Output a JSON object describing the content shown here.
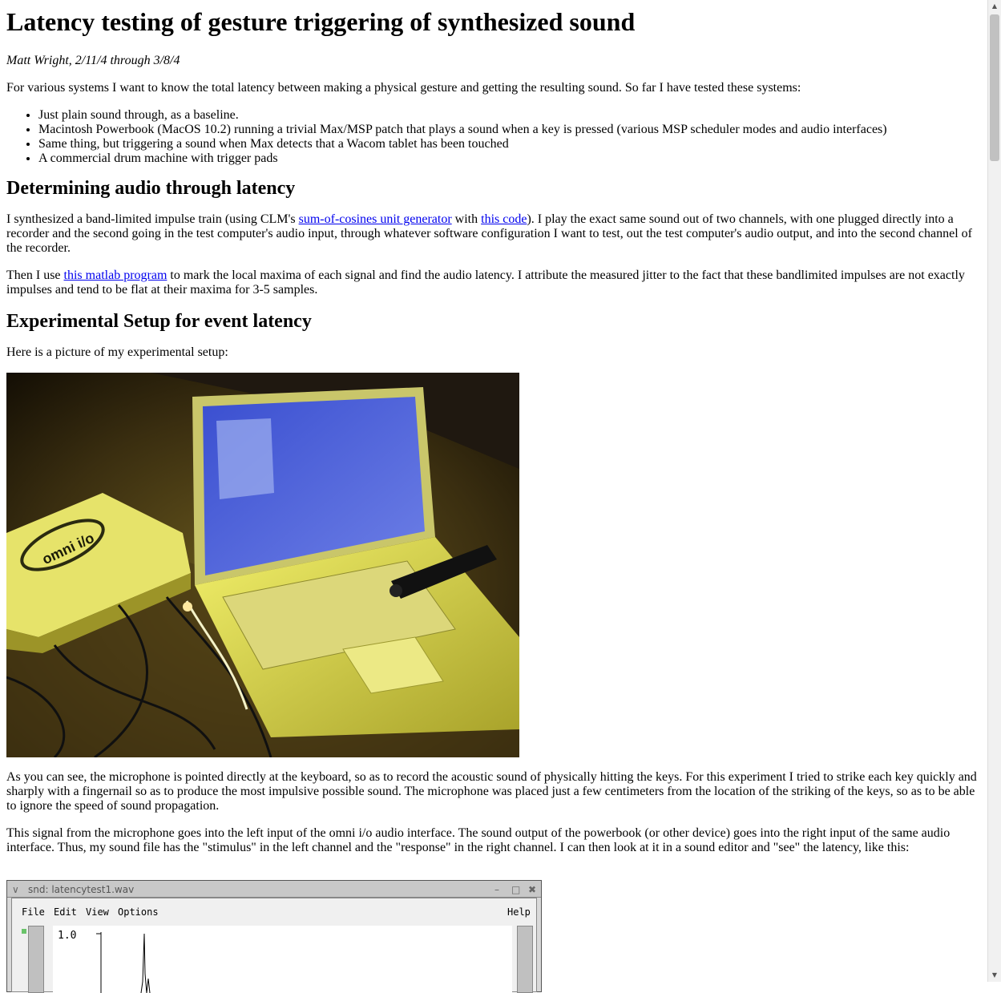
{
  "title": "Latency testing of gesture triggering of synthesized sound",
  "author_line": "Matt Wright, 2/11/4 through 3/8/4",
  "intro": "For various systems I want to know the total latency between making a physical gesture and getting the resulting sound. So far I have tested these systems:",
  "systems": [
    "Just plain sound through, as a baseline.",
    "Macintosh Powerbook (MacOS 10.2) running a trivial Max/MSP patch that plays a sound when a key is pressed (various MSP scheduler modes and audio interfaces)",
    "Same thing, but triggering a sound when Max detects that a Wacom tablet has been touched",
    "A commercial drum machine with trigger pads"
  ],
  "section_audio": {
    "heading": "Determining audio through latency",
    "p1_a": "I synthesized a band-limited impulse train (using CLM's ",
    "p1_link1": "sum-of-cosines unit generator",
    "p1_b": " with ",
    "p1_link2": "this code",
    "p1_c": "). I play the exact same sound out of two channels, with one plugged directly into a recorder and the second going in the test computer's audio input, through whatever software configuration I want to test, out the test computer's audio output, and into the second channel of the recorder.",
    "p2_a": "Then I use ",
    "p2_link": "this matlab program",
    "p2_b": " to mark the local maxima of each signal and find the audio latency. I attribute the measured jitter to the fact that these bandlimited impulses are not exactly impulses and tend to be flat at their maxima for 3-5 samples."
  },
  "section_setup": {
    "heading": "Experimental Setup for event latency",
    "p_picture": "Here is a picture of my experimental setup:",
    "photo_device_label": "omni i/o",
    "p_seen": "As you can see, the microphone is pointed directly at the keyboard, so as to record the acoustic sound of physically hitting the keys. For this experiment I tried to strike each key quickly and sharply with a fingernail so as to produce the most impulsive possible sound. The microphone was placed just a few centimeters from the location of the striking of the keys, so as to be able to ignore the speed of sound propagation.",
    "p_signal": "This signal from the microphone goes into the left input of the omni i/o audio interface. The sound output of the powerbook (or other device) goes into the right input of the same audio interface. Thus, my sound file has the \"stimulus\" in the left channel and the \"response\" in the right channel. I can then look at it in a sound editor and \"see\" the latency, like this:"
  },
  "snd_window": {
    "title": "snd: latencytest1.wav",
    "menu": [
      "File",
      "Edit",
      "View",
      "Options"
    ],
    "help": "Help",
    "y_tick": "1.0"
  }
}
